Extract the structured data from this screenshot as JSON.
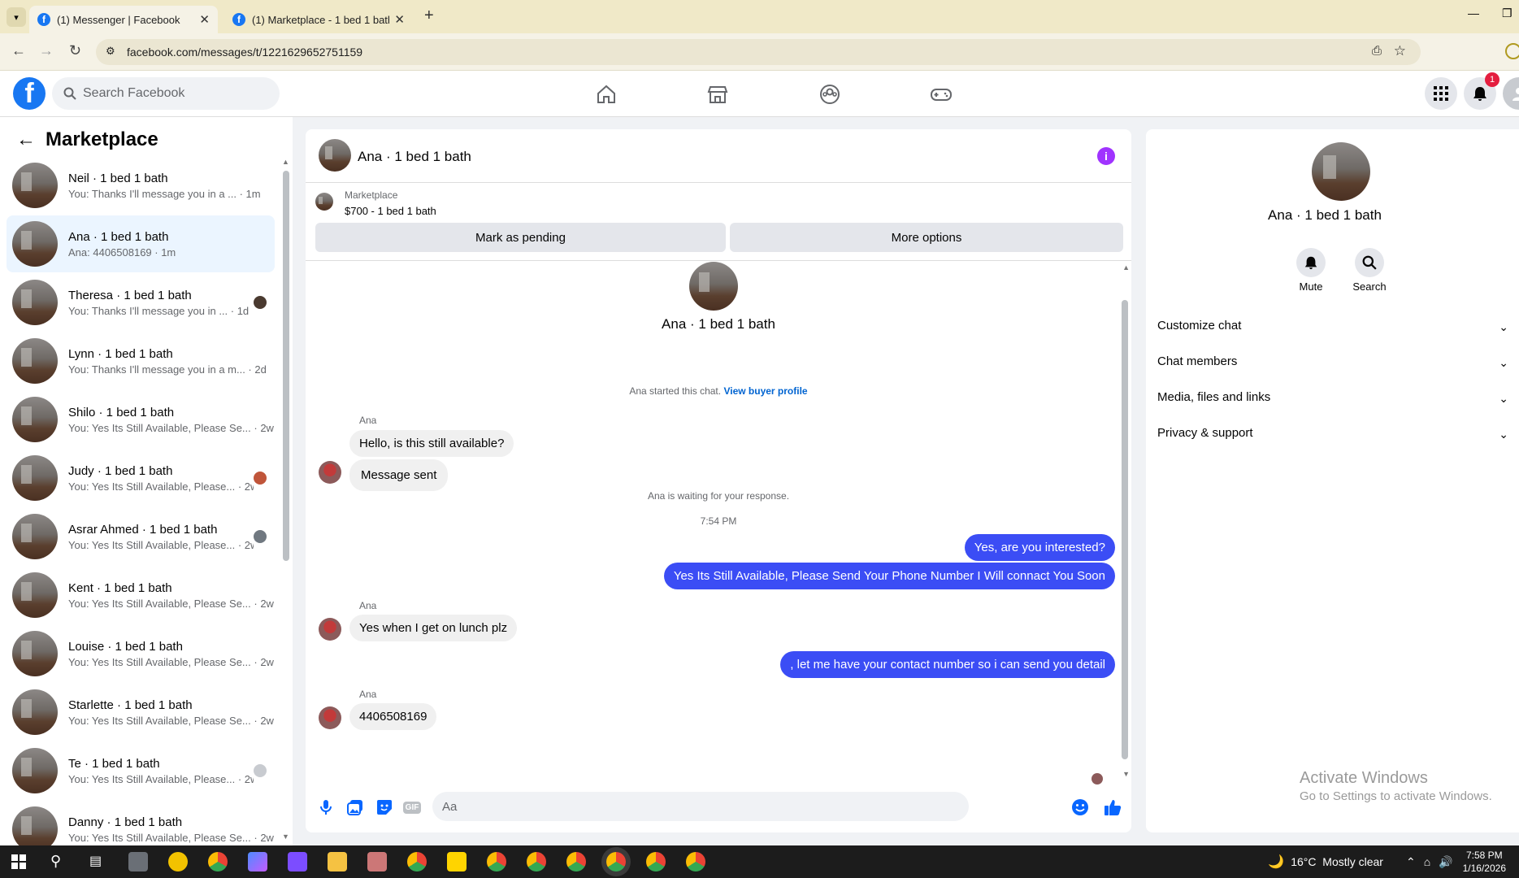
{
  "browser": {
    "tabs": [
      {
        "title": "(1) Messenger | Facebook"
      },
      {
        "title": "(1) Marketplace - 1 bed 1 bath |"
      }
    ],
    "url": "facebook.com/messages/t/1221629652751159",
    "new_tab": "+"
  },
  "fb": {
    "search_placeholder": "Search Facebook",
    "notification_count": "1"
  },
  "sidebar": {
    "title": "Marketplace",
    "conversations": [
      {
        "name": "Neil · 1 bed 1 bath",
        "preview": "You: Thanks I'll message you in a ... · 1m"
      },
      {
        "name": "Ana · 1 bed 1 bath",
        "preview": "Ana: 4406508169 · 1m"
      },
      {
        "name": "Theresa · 1 bed 1 bath",
        "preview": "You: Thanks I'll message you in ... · 1d"
      },
      {
        "name": "Lynn · 1 bed 1 bath",
        "preview": "You: Thanks I'll message you in a m... · 2d"
      },
      {
        "name": "Shilo · 1 bed 1 bath",
        "preview": "You: Yes Its Still Available, Please Se... · 2w"
      },
      {
        "name": "Judy · 1 bed 1 bath",
        "preview": "You: Yes Its Still Available, Please... · 2w"
      },
      {
        "name": "Asrar Ahmed · 1 bed 1 bath",
        "preview": "You: Yes Its Still Available, Please... · 2w"
      },
      {
        "name": "Kent · 1 bed 1 bath",
        "preview": "You: Yes Its Still Available, Please Se... · 2w"
      },
      {
        "name": "Louise · 1 bed 1 bath",
        "preview": "You: Yes Its Still Available, Please Se... · 2w"
      },
      {
        "name": "Starlette · 1 bed 1 bath",
        "preview": "You: Yes Its Still Available, Please Se... · 2w"
      },
      {
        "name": "Te · 1 bed 1 bath",
        "preview": "You: Yes Its Still Available, Please... · 2w"
      },
      {
        "name": "Danny · 1 bed 1 bath",
        "preview": "You: Yes Its Still Available, Please Se... · 2w"
      }
    ]
  },
  "chat": {
    "header_name": "Ana · 1 bed 1 bath",
    "marketplace_label": "Marketplace",
    "listing": "$700 - 1 bed 1 bath",
    "mark_pending": "Mark as pending",
    "more_options": "More options",
    "intro_name": "Ana · 1 bed 1 bath",
    "started_text": "Ana started this chat.",
    "view_profile": "View buyer profile",
    "sender": "Ana",
    "msg1": "Hello, is this still available?",
    "msg2": "Message sent",
    "waiting": "Ana is waiting for your response.",
    "time": "7:54 PM",
    "out1": "Yes, are you interested?",
    "out2": "Yes Its Still Available, Please Send Your Phone Number I Will connact You Soon",
    "msg3": "Yes when I get on lunch plz",
    "out3": ", let me have your contact number so i can send you detail",
    "msg4": "4406508169",
    "composer_placeholder": "Aa"
  },
  "right": {
    "name": "Ana · 1 bed 1 bath",
    "mute": "Mute",
    "search": "Search",
    "sections": [
      "Customize chat",
      "Chat members",
      "Media, files and links",
      "Privacy & support"
    ]
  },
  "watermark": {
    "line1": "Activate Windows",
    "line2": "Go to Settings to activate Windows."
  },
  "taskbar": {
    "weather": "16°C  Mostly clear",
    "time": "7:58 PM",
    "date": "1/16/2026"
  },
  "colors": {
    "fb_blue": "#1877f2",
    "out_bubble": "#3b4df5",
    "info_purple": "#a033ff"
  }
}
